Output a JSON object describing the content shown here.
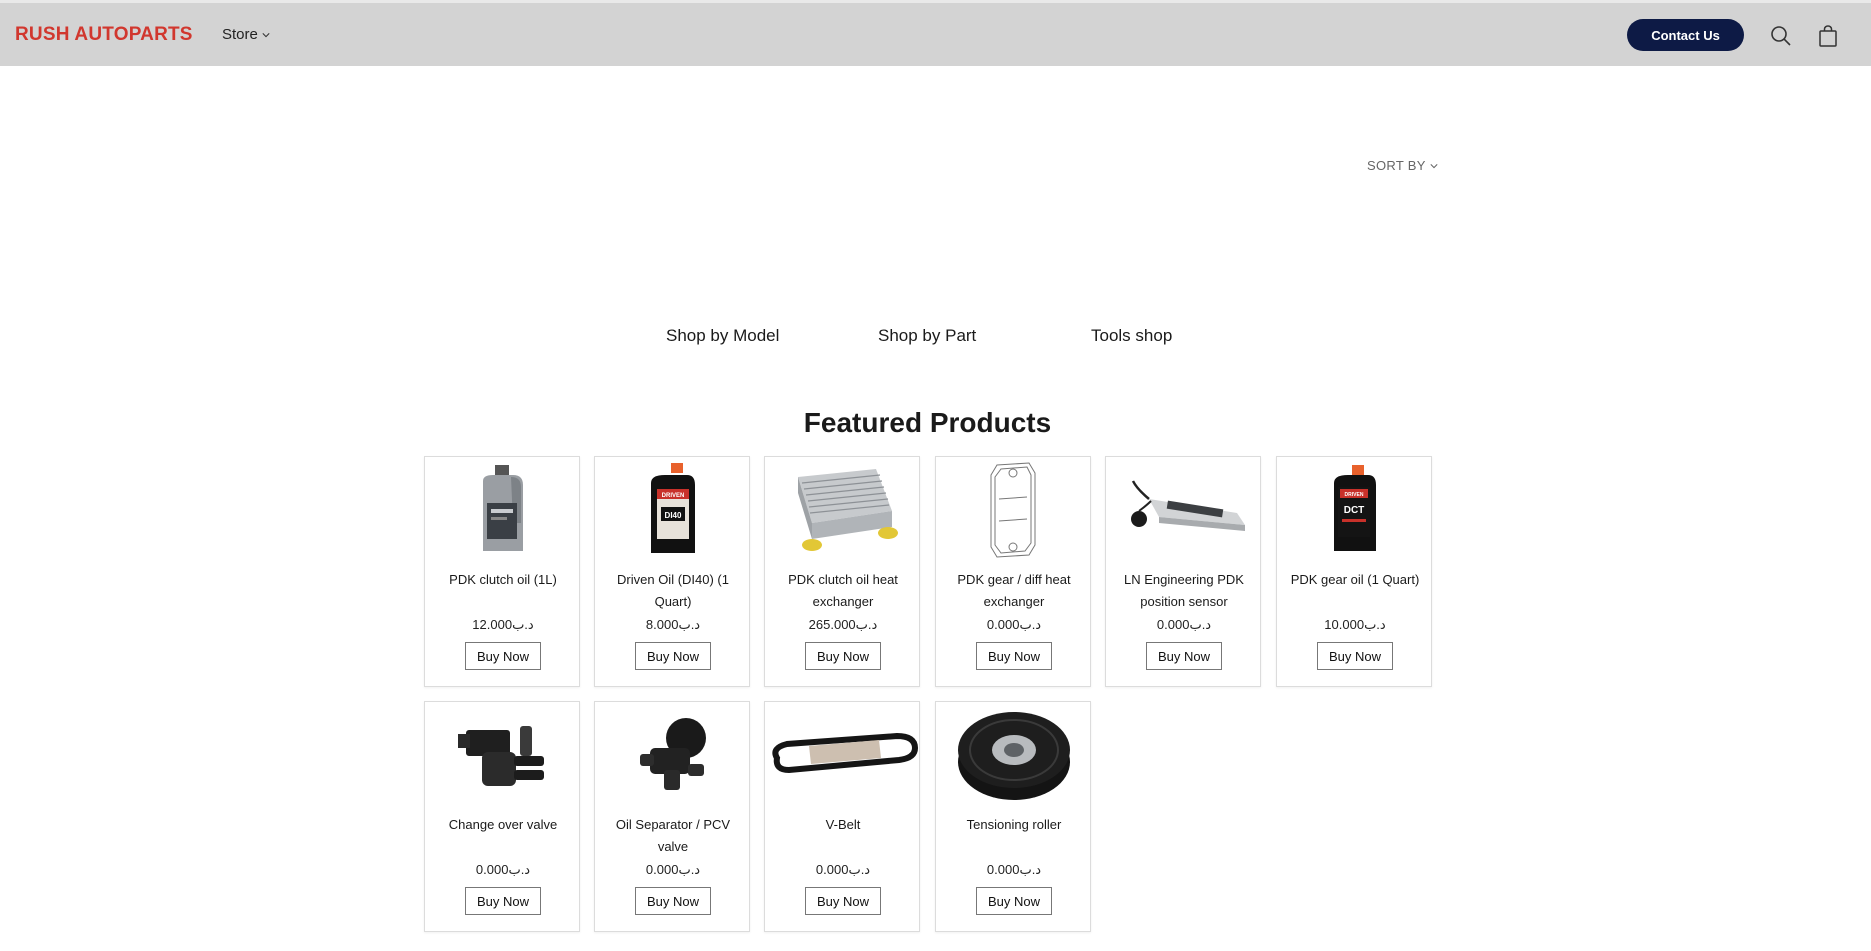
{
  "header": {
    "logo": "RUSH AUTOPARTS",
    "store_label": "Store",
    "contact_label": "Contact Us",
    "search_icon": "search-icon",
    "cart_icon": "shopping-bag-icon",
    "brand_color": "#d1372e",
    "button_color": "#0d1a45"
  },
  "sort": {
    "label": "SORT BY"
  },
  "shop_links": [
    "Shop by Model",
    "Shop by Part",
    "Tools shop"
  ],
  "featured": {
    "title": "Featured Products",
    "buy_label": "Buy Now",
    "products": [
      {
        "name": "PDK clutch oil (1L)",
        "price": "12.000د.ب",
        "image": "oil-bottle-grey"
      },
      {
        "name": "Driven Oil (DI40) (1 Quart)",
        "price": "8.000د.ب",
        "image": "oil-bottle-driven"
      },
      {
        "name": "PDK clutch oil heat exchanger",
        "price": "265.000د.ب",
        "image": "heat-exchanger"
      },
      {
        "name": "PDK gear / diff heat exchanger",
        "price": "0.000د.ب",
        "image": "heat-exchanger-sketch"
      },
      {
        "name": "LN Engineering PDK position sensor",
        "price": "0.000د.ب",
        "image": "position-sensor"
      },
      {
        "name": "PDK gear oil (1 Quart)",
        "price": "10.000د.ب",
        "image": "oil-bottle-dct"
      },
      {
        "name": "Change over valve",
        "price": "0.000د.ب",
        "image": "change-over-valve"
      },
      {
        "name": "Oil Separator / PCV valve",
        "price": "0.000د.ب",
        "image": "pcv-valve"
      },
      {
        "name": "V-Belt",
        "price": "0.000د.ب",
        "image": "v-belt"
      },
      {
        "name": "Tensioning roller",
        "price": "0.000د.ب",
        "image": "tensioning-roller"
      }
    ]
  }
}
